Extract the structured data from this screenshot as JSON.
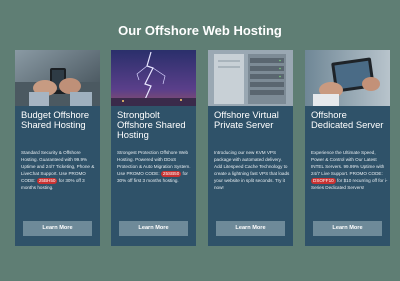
{
  "page": {
    "title": "Our Offshore Web Hosting"
  },
  "cards": [
    {
      "title": "Budget Offshore Shared Hosting",
      "image_icon": "phone-in-hands-image",
      "desc_before": "Standard Security & Offshore Hosting. Guaranteed with 99.9% Uptime and 24/7 Ticketing, Phone & LiveChat Support. Use PROMO CODE:",
      "promo": "25BH50",
      "desc_after": "for 30% off 3 months hosting.",
      "button": "Learn More"
    },
    {
      "title": "Strongbolt Offshore Shared Hosting",
      "image_icon": "lightning-storm-image",
      "desc_before": "Strongest Protection Offshore Web Hosting. Powered with DDoS Protection & Auto Migration System. Use PROMO CODE:",
      "promo": "25SB50",
      "desc_after": "for 30% off first 3 months hosting.",
      "button": "Learn More"
    },
    {
      "title": "Offshore Virtual Private Server",
      "image_icon": "server-rack-image",
      "desc_before": "Introducing our new KVM VPS package with automated delivery. Add Litespeed Cache Technology to create a lightning fast VPS that loads your website in split seconds. Try it now!",
      "promo": "",
      "desc_after": "",
      "button": "Learn More"
    },
    {
      "title": "Offshore Dedicated Server",
      "image_icon": "tablet-in-hands-image",
      "desc_before": "Experience the Ultimate Speed, Power & Control with Our Latest INTEL Servers. 99.99% Uptime with 24/7 Live Support. PROMO CODE:",
      "promo": "DSOFF10",
      "desc_after": "for $10 recurring off for i-Series Dedicated Servers!",
      "button": "Learn More"
    }
  ],
  "colors": {
    "background": "#5f7e74",
    "card": "#2f5269",
    "button": "#6e8a99",
    "promo": "#c93232"
  }
}
